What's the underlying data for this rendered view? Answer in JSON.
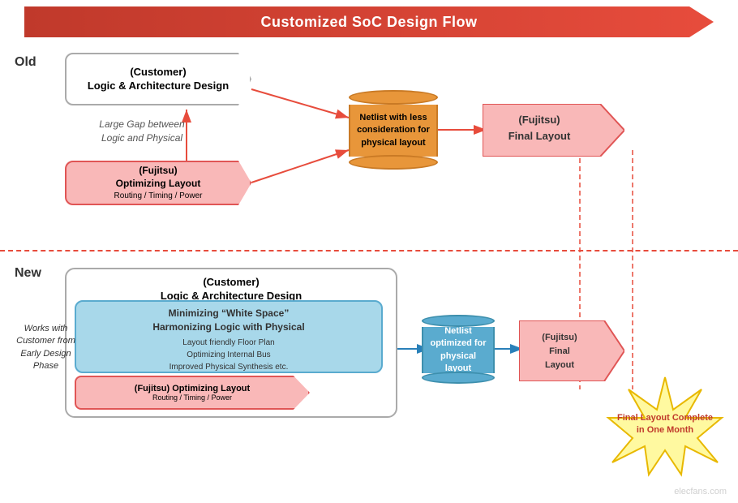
{
  "title": "Customized SoC Design Flow",
  "sections": {
    "old_label": "Old",
    "new_label": "New"
  },
  "old": {
    "customer_box": {
      "line1": "(Customer)",
      "line2": "Logic & Architecture Design"
    },
    "gap_text": "Large Gap between\nLogic and Physical",
    "fujitsu_opt_box": {
      "line1": "(Fujitsu)",
      "line2": "Optimizing Layout",
      "line3": "Routing / Timing / Power"
    },
    "cylinder": {
      "line1": "Netlist with less",
      "line2": "consideration for",
      "line3": "physical layout"
    },
    "final_layout": {
      "line1": "(Fujitsu)",
      "line2": "Final Layout"
    }
  },
  "new": {
    "customer_box": {
      "line1": "(Customer)",
      "line2": "Logic & Architecture Design"
    },
    "inner_box": {
      "title1": "Minimizing “White Space”",
      "title2": "Harmonizing Logic with Physical",
      "items": [
        "Layout friendly Floor Plan",
        "Optimizing Internal Bus",
        "Improved  Physical Synthesis etc."
      ]
    },
    "fujitsu_opt_box": {
      "line1": "(Fujitsu)",
      "line2": "Optimizing Layout",
      "line3": "Routing / Timing / Power"
    },
    "cylinder": {
      "line1": "Netlist",
      "line2": "optimized for",
      "line3": "physical layout"
    },
    "final_layout": {
      "line1": "(Fujitsu)",
      "line2": "Final",
      "line3": "Layout"
    },
    "starburst_text": "Final Layout Complete\nin One Month",
    "works_text": "Works with\nCustomer from\nEarly Design Phase"
  },
  "watermark": "elecfans.com"
}
